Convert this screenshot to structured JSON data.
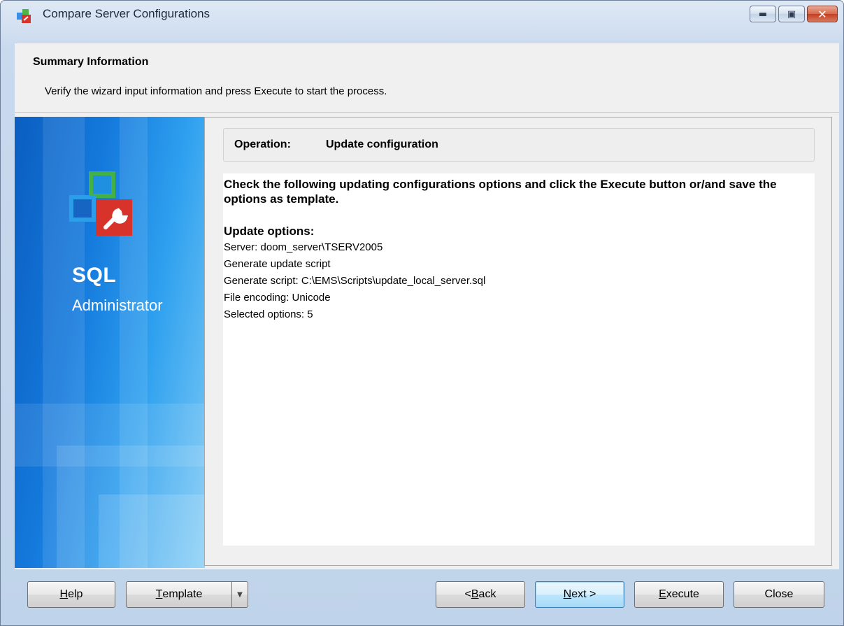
{
  "window": {
    "title": "Compare Server Configurations",
    "caption_buttons": [
      "minimize-icon",
      "maximize-icon",
      "close-icon"
    ]
  },
  "header": {
    "title": "Summary Information",
    "subtitle": "Verify the wizard input information and press Execute to start the process."
  },
  "banner": {
    "product_line1": "SQL",
    "product_line2": "Administrator"
  },
  "operation": {
    "label": "Operation:",
    "value": "Update configuration"
  },
  "summary": {
    "heading": "Check the following updating configurations options and click the Execute button or/and save the options as template.",
    "options_title": "Update options:",
    "lines": [
      "Server: doom_server\\TSERV2005",
      "Generate update script",
      "Generate script: C:\\EMS\\Scripts\\update_local_server.sql",
      "File encoding: Unicode",
      "Selected options: 5"
    ]
  },
  "buttons": {
    "help": {
      "hotkey": "H",
      "rest": "elp"
    },
    "template": {
      "hotkey": "T",
      "rest": "emplate"
    },
    "back": {
      "prefix": "< ",
      "hotkey": "B",
      "rest": "ack"
    },
    "next": {
      "hotkey": "N",
      "rest": "ext >"
    },
    "execute": {
      "hotkey": "E",
      "rest": "xecute"
    },
    "close": "Close"
  },
  "colors": {
    "banner_blue": "#1479dc",
    "default_button_border": "#3c7fb1"
  }
}
